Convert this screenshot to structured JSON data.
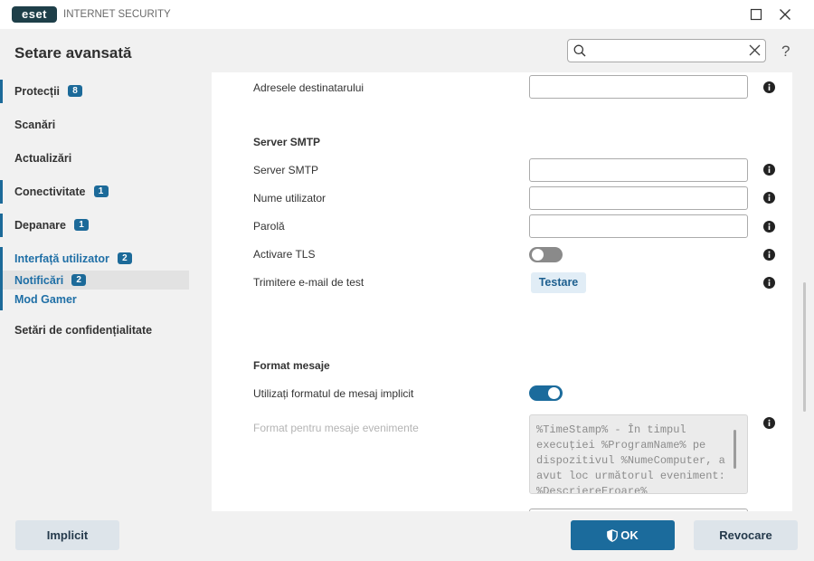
{
  "app": {
    "logo_text": "eset",
    "product_name": "INTERNET SECURITY"
  },
  "window_controls": {
    "maximize_icon": "maximize-icon",
    "close_icon": "close-icon"
  },
  "header": {
    "title": "Setare avansată",
    "search": {
      "value": "",
      "search_icon": "search-icon",
      "clear_icon": "clear-icon"
    },
    "help_label": "?"
  },
  "sidebar": {
    "items": [
      {
        "label": "Protecții",
        "badge": "8"
      },
      {
        "label": "Scanări"
      },
      {
        "label": "Actualizări"
      },
      {
        "label": "Conectivitate",
        "badge": "1"
      },
      {
        "label": "Depanare",
        "badge": "1"
      },
      {
        "label": "Interfață utilizator",
        "badge": "2",
        "expanded": true
      },
      {
        "label": "Notificări",
        "badge": "2",
        "selected": true
      },
      {
        "label": "Mod Gamer"
      },
      {
        "label": "Setări de confidențialitate"
      }
    ]
  },
  "content": {
    "recipients": {
      "label": "Adresele destinatarului",
      "value": ""
    },
    "smtp": {
      "heading": "Server SMTP",
      "server": {
        "label": "Server SMTP",
        "value": ""
      },
      "username": {
        "label": "Nume utilizator",
        "value": ""
      },
      "password": {
        "label": "Parolă",
        "value": ""
      },
      "tls": {
        "label": "Activare TLS",
        "enabled": false
      },
      "test_email": {
        "label": "Trimitere e-mail de test",
        "button_label": "Testare"
      }
    },
    "message_format": {
      "heading": "Format mesaje",
      "use_default": {
        "label": "Utilizați formatul de mesaj implicit",
        "enabled": true
      },
      "event_format": {
        "label": "Format pentru mesaje evenimente",
        "value": "%TimeStamp% - În timpul execuției %ProgramName% pe dispozitivul %NumeComputer, a avut loc următorul eveniment: %DescriereEroare%",
        "disabled": true
      }
    },
    "info_icon": "info-icon"
  },
  "footer": {
    "default_label": "Implicit",
    "ok_label": "OK",
    "ok_icon": "shield-icon",
    "cancel_label": "Revocare"
  },
  "colors": {
    "accent": "#1b6b9c",
    "accent_text": "#1f6fa6",
    "badge": "#1c6a99",
    "panel": "#ffffff",
    "chrome": "#f1f1f1"
  }
}
